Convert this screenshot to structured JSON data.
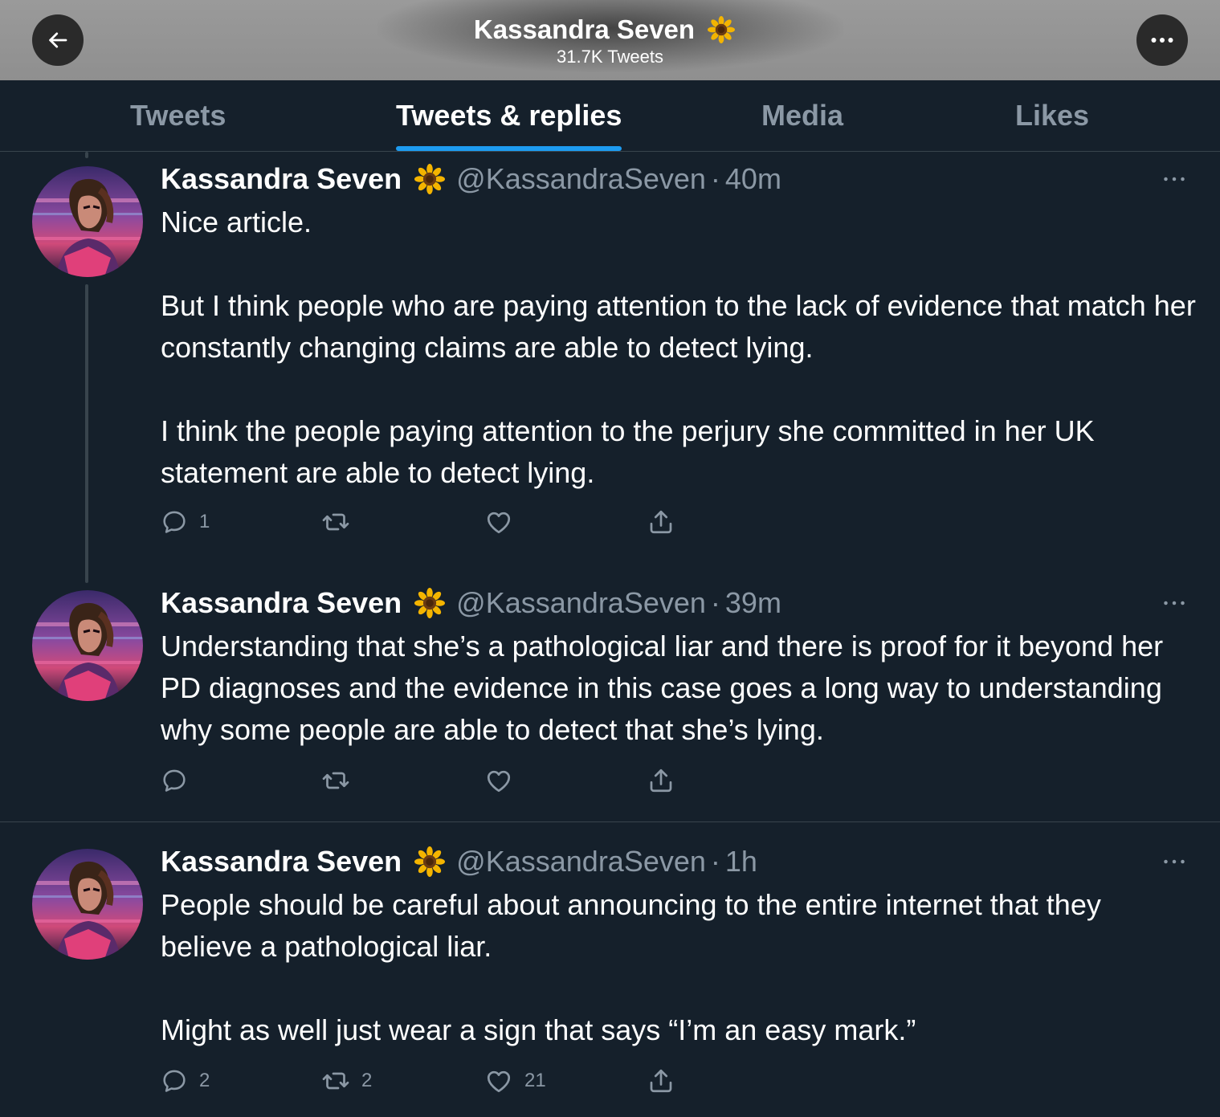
{
  "header": {
    "title": "Kassandra Seven",
    "subtitle": "31.7K Tweets",
    "back_icon": "arrow-left-icon",
    "more_icon": "ellipsis-icon",
    "title_emoji": "sunflower-icon"
  },
  "tabs": [
    {
      "label": "Tweets",
      "active": false
    },
    {
      "label": "Tweets & replies",
      "active": true
    },
    {
      "label": "Media",
      "active": false
    },
    {
      "label": "Likes",
      "active": false
    }
  ],
  "colors": {
    "background": "#15202b",
    "accent": "#1d9bf0",
    "secondary_text": "#8b98a5",
    "divider": "#38444d"
  },
  "tweets": [
    {
      "name": "Kassandra Seven",
      "handle": "@KassandraSeven",
      "dot": "·",
      "time": "40m",
      "paragraphs": [
        "Nice article.",
        "But I think people who are paying attention to the lack of evidence that match her constantly changing claims are able to detect lying.",
        "I think the people paying attention to the perjury she committed in her UK statement are able to detect lying."
      ],
      "reply_count": "1",
      "retweet_count": "",
      "like_count": "",
      "actions": [
        "reply-icon",
        "retweet-icon",
        "like-icon",
        "share-icon"
      ]
    },
    {
      "name": "Kassandra Seven",
      "handle": "@KassandraSeven",
      "dot": "·",
      "time": "39m",
      "paragraphs": [
        "Understanding that she’s a pathological liar and there is proof for it beyond her PD diagnoses and the evidence in this case goes a long way to understanding why some people are able to detect that she’s lying."
      ],
      "reply_count": "",
      "retweet_count": "",
      "like_count": "",
      "actions": [
        "reply-icon",
        "retweet-icon",
        "like-icon",
        "share-icon"
      ]
    },
    {
      "name": "Kassandra Seven",
      "handle": "@KassandraSeven",
      "dot": "·",
      "time": "1h",
      "paragraphs": [
        "People should be careful about announcing to the entire internet that they believe a pathological liar.",
        "Might as well just wear a sign that says “I’m an easy mark.”"
      ],
      "reply_count": "2",
      "retweet_count": "2",
      "like_count": "21",
      "actions": [
        "reply-icon",
        "retweet-icon",
        "like-icon",
        "share-icon"
      ]
    }
  ]
}
